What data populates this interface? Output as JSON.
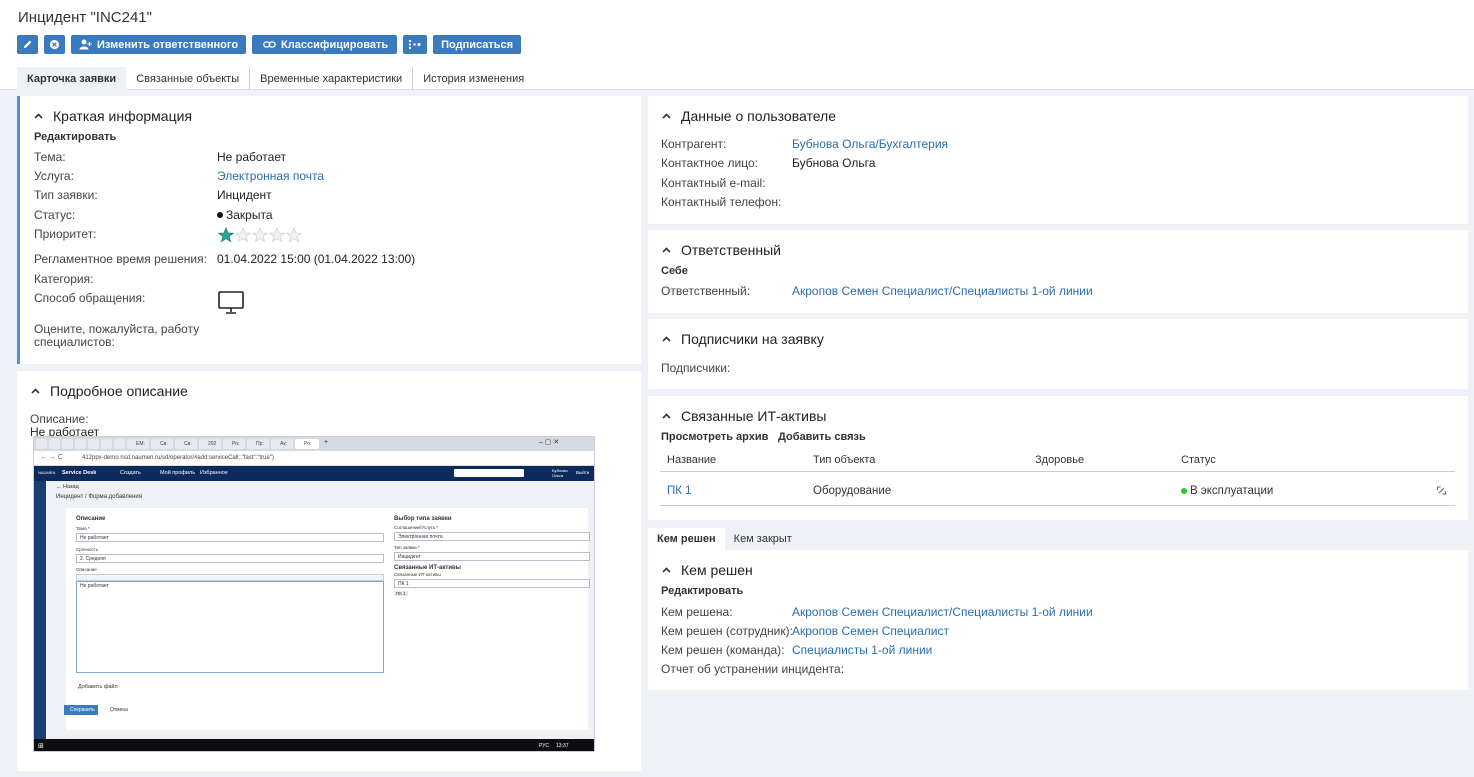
{
  "header": {
    "title": "Инцидент \"INC241\"",
    "buttons": {
      "change_responsible": "Изменить ответственного",
      "classify": "Классифицировать",
      "subscribe": "Подписаться"
    }
  },
  "tabs": [
    "Карточка заявки",
    "Связанные объекты",
    "Временные характеристики",
    "История изменения"
  ],
  "brief": {
    "title": "Краткая информация",
    "edit": "Редактировать",
    "fields": {
      "topic_label": "Тема:",
      "topic": "Не работает",
      "service_label": "Услуга:",
      "service": "Электронная почта",
      "type_label": "Тип заявки:",
      "type": "Инцидент",
      "status_label": "Статус:",
      "status": "Закрыта",
      "priority_label": "Приоритет:",
      "sla_label": "Регламентное время решения:",
      "sla": "01.04.2022 15:00 (01.04.2022 13:00)",
      "category_label": "Категория:",
      "channel_label": "Способ обращения:",
      "rating_label": "Оцените, пожалуйста, работу специалистов:"
    },
    "priority_rating": 1,
    "priority_max": 5
  },
  "detail": {
    "title": "Подробное описание",
    "desc_label": "Описание:",
    "desc_value": "Не работает",
    "screenshot": {
      "browser_tabs": [
        "",
        "",
        "",
        "",
        "",
        "",
        "",
        "ЕМ:",
        "Св:",
        "Св:",
        "202",
        "Ро:",
        "Пр:",
        "Ак:",
        "Ро:"
      ],
      "url": "412ppx-demo.nsd.naumen.ru/sd/operator/#add:serviceCall::\"fast\":\"true\")",
      "app_brand": "Service Desk",
      "app_menu": [
        "Создать",
        "Мой профиль",
        "Избранное"
      ],
      "back": "← Назад",
      "breadcrumb": "Инцидент / Форма добавления",
      "left_section": "Описание",
      "topic_label": "Тема *",
      "topic_value": "Не работает",
      "urgency_label": "Срочность",
      "urgency_value": "2. Средняя",
      "desc_label": "Описание",
      "desc_value": "Не работает",
      "attach": "Добавить файл",
      "save": "Сохранить",
      "cancel": "Отмена",
      "right_section": "Выбор типа заявки",
      "service_label": "Соглашение/Услуга *",
      "service_value": "Электронная почта",
      "type_label": "Тип заявки *",
      "type_value": "Инцидент",
      "assets_section": "Связанные ИТ-активы",
      "assets_label": "Связанные ИТ-активы",
      "asset_value": "ПК 1",
      "asset_chip": "ПК 1",
      "user_name": "Бубнова Ольга",
      "exit": "Выйти",
      "lang": "РУС",
      "time": "13:37"
    }
  },
  "userdata": {
    "title": "Данные о пользователе",
    "counterparty_label": "Контрагент:",
    "counterparty": "Бубнова Ольга/Бухгалтерия",
    "contact_label": "Контактное лицо:",
    "contact": "Бубнова Ольга",
    "email_label": "Контактный e-mail:",
    "phone_label": "Контактный телефон:"
  },
  "responsible": {
    "title": "Ответственный",
    "self": "Себе",
    "label": "Ответственный:",
    "value": "Акропов Семен Специалист/Специалисты 1-ой линии"
  },
  "subscribers": {
    "title": "Подписчики на заявку",
    "label": "Подписчики:"
  },
  "itassets": {
    "title": "Связанные ИТ-активы",
    "view_archive": "Просмотреть архив",
    "add_link": "Добавить связь",
    "columns": [
      "Название",
      "Тип объекта",
      "Здоровье",
      "Статус"
    ],
    "rows": [
      {
        "name": "ПК 1",
        "type": "Оборудование",
        "health": "",
        "status": "В эксплуатации"
      }
    ]
  },
  "subtabs": [
    "Кем решен",
    "Кем закрыт"
  ],
  "resolved": {
    "title": "Кем решен",
    "edit": "Редактировать",
    "by_label": "Кем решена:",
    "by": "Акропов Семен Специалист/Специалисты 1-ой линии",
    "by_employee_label": "Кем решен (сотрудник):",
    "by_employee": "Акропов Семен Специалист",
    "by_team_label": "Кем решен (команда):",
    "by_team": "Специалисты 1-ой линии",
    "report_label": "Отчет об устранении инцидента:"
  },
  "colors": {
    "accent": "#3a7bbf",
    "link": "#2a6db0",
    "status_active": "#22cc22",
    "star_filled": "#2fa39a"
  }
}
